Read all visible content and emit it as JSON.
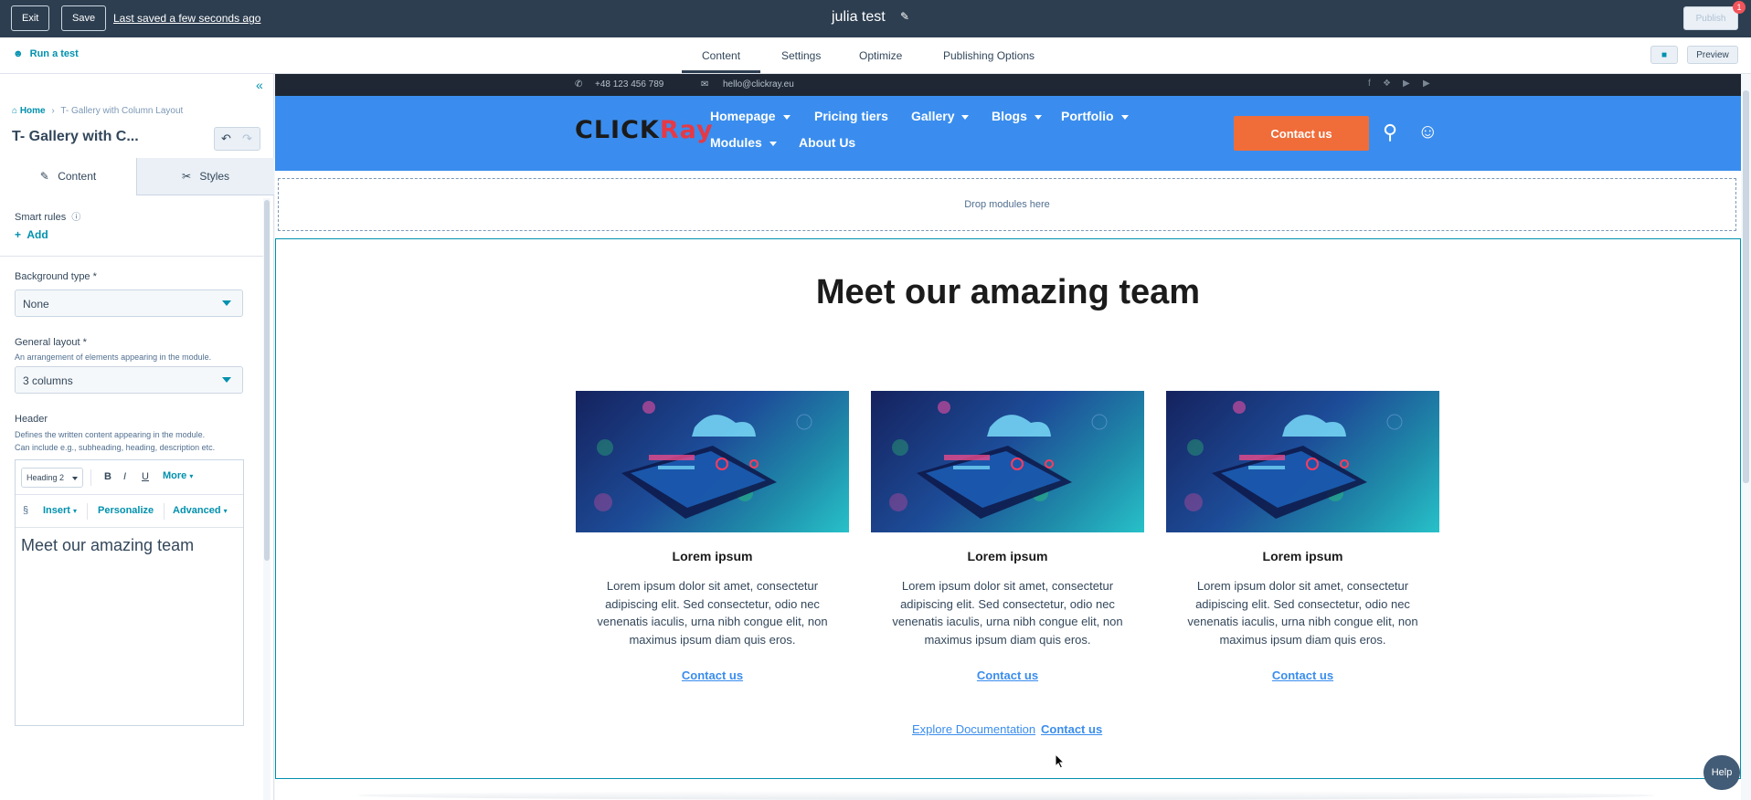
{
  "topbar": {
    "exit_label": "Exit",
    "save_label": "Save",
    "last_saved": "Last saved a few seconds ago",
    "doc_title": "julia test",
    "publish_label": "Publish",
    "notification_count": "1"
  },
  "nav": {
    "run_test": "Run a test",
    "tabs": [
      {
        "label": "Content",
        "active": true
      },
      {
        "label": "Settings",
        "active": false
      },
      {
        "label": "Optimize",
        "active": false
      },
      {
        "label": "Publishing Options",
        "active": false
      }
    ],
    "preview_label": "Preview"
  },
  "sidebar": {
    "breadcrumb": {
      "home": "Home",
      "current": "T- Gallery with Column Layout"
    },
    "module_title": "T- Gallery with C...",
    "tabs": {
      "content": "Content",
      "styles": "Styles"
    },
    "smart_rules": {
      "label": "Smart rules",
      "add": "Add"
    },
    "background_type": {
      "label": "Background type *",
      "value": "None"
    },
    "general_layout": {
      "label": "General layout *",
      "help": "An arrangement of elements appearing in the module.",
      "value": "3 columns"
    },
    "header": {
      "label": "Header",
      "help_line1": "Defines the written content appearing in the module.",
      "help_line2": "Can include e.g., subheading, heading, description etc."
    },
    "editor": {
      "heading_select": "Heading 2",
      "bold": "B",
      "italic": "I",
      "underline": "U",
      "more": "More",
      "insert": "Insert",
      "personalize": "Personalize",
      "advanced": "Advanced",
      "body_text": "Meet our amazing team"
    }
  },
  "site": {
    "infobar": {
      "phone": "+48 123 456 789",
      "email": "hello@clickray.eu"
    },
    "logo": {
      "part1": "CLICK",
      "part2": "Ray"
    },
    "nav_items": [
      {
        "label": "Homepage",
        "dropdown": true
      },
      {
        "label": "Pricing tiers",
        "dropdown": false
      },
      {
        "label": "Gallery",
        "dropdown": true
      },
      {
        "label": "Blogs",
        "dropdown": true
      },
      {
        "label": "Portfolio",
        "dropdown": true
      },
      {
        "label": "Modules",
        "dropdown": true
      },
      {
        "label": "About Us",
        "dropdown": false
      }
    ],
    "contact_button": "Contact us",
    "dropzone": "Drop modules here",
    "team_title": "Meet our amazing team",
    "cards": [
      {
        "name": "Lorem ipsum",
        "line1": "Lorem ipsum dolor sit amet, consectetur",
        "line2": "adipiscing elit. Sed consectetur, odio nec",
        "line3": "venenatis iaculis, urna nibh congue elit, non",
        "line4": "maximus ipsum diam quis eros.",
        "link": "Contact us"
      },
      {
        "name": "Lorem ipsum",
        "line1": "Lorem ipsum dolor sit amet, consectetur",
        "line2": "adipiscing elit. Sed consectetur, odio nec",
        "line3": "venenatis iaculis, urna nibh congue elit, non",
        "line4": "maximus ipsum diam quis eros.",
        "link": "Contact us"
      },
      {
        "name": "Lorem ipsum",
        "line1": "Lorem ipsum dolor sit amet, consectetur",
        "line2": "adipiscing elit. Sed consectetur, odio nec",
        "line3": "venenatis iaculis, urna nibh congue elit, non",
        "line4": "maximus ipsum diam quis eros.",
        "link": "Contact us"
      }
    ],
    "footer_links": {
      "explore": "Explore Documentation",
      "contact": "Contact us"
    }
  },
  "help_button": "Help",
  "colors": {
    "topbar": "#2d3e50",
    "accent": "#0091ae",
    "site_nav": "#3a8dee",
    "contact_button": "#f06d3a"
  }
}
